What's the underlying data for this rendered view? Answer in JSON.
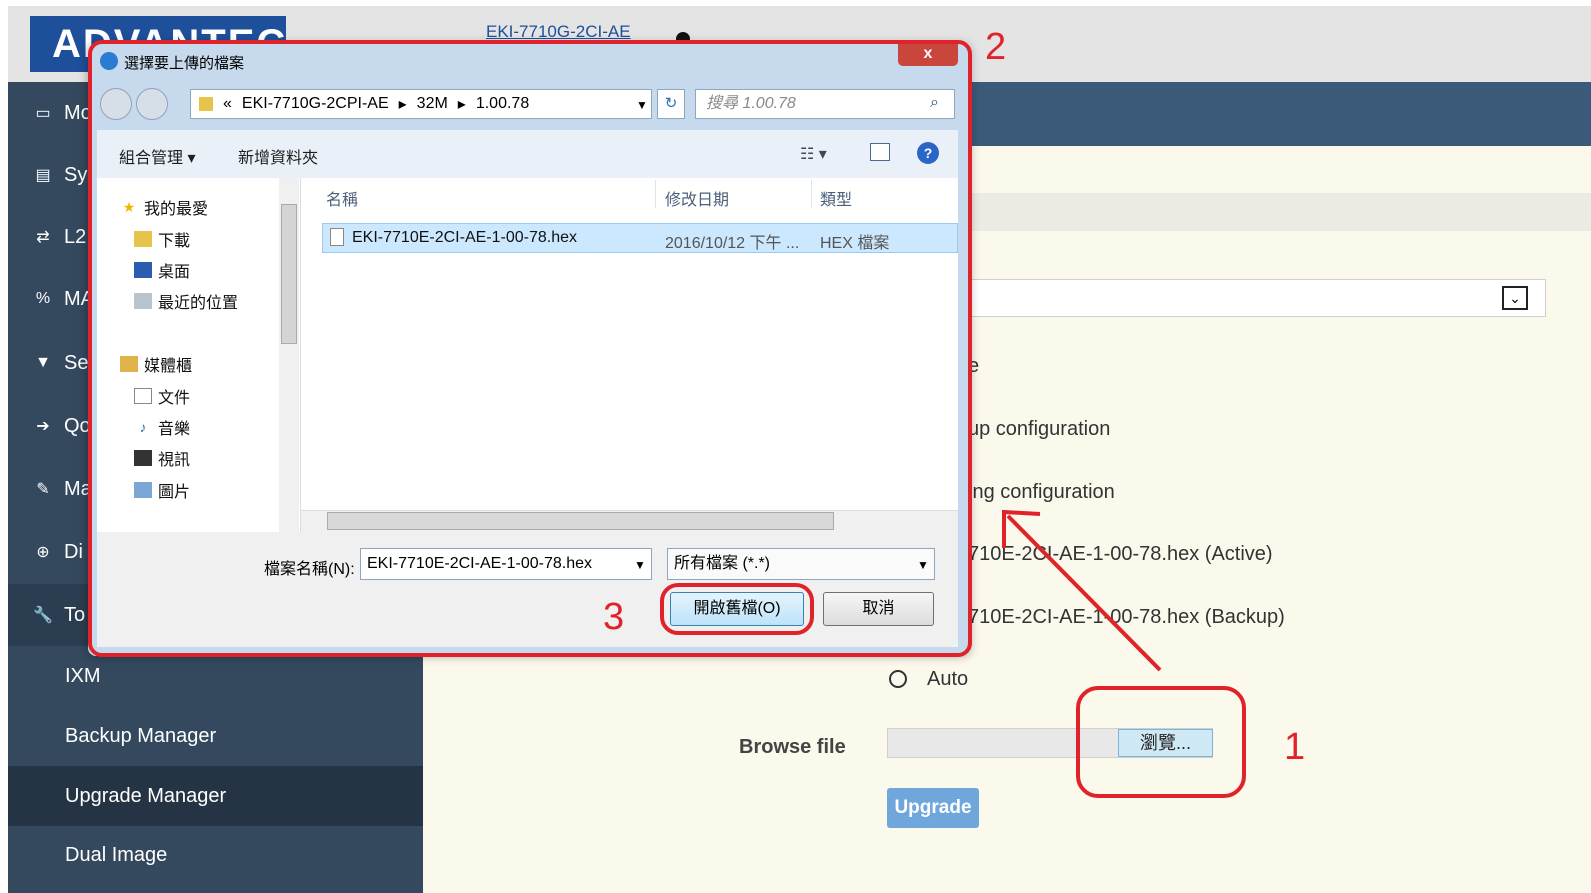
{
  "app": {
    "logo_text": "ADVANTECH",
    "model": "EKI-7710G-2CI-AE"
  },
  "sidebar": {
    "items": [
      {
        "label": "Mo",
        "icon": "monitor-icon"
      },
      {
        "label": "Sy",
        "icon": "system-icon"
      },
      {
        "label": "L2",
        "icon": "swap-icon"
      },
      {
        "label": "MA",
        "icon": "link-icon"
      },
      {
        "label": "Se",
        "icon": "shield-icon"
      },
      {
        "label": "Qo",
        "icon": "signin-icon"
      },
      {
        "label": "Ma",
        "icon": "edit-icon"
      },
      {
        "label": "Di",
        "icon": "zoom-icon"
      },
      {
        "label": "To",
        "icon": "wrench-icon"
      }
    ],
    "sub_items": [
      "IXM",
      "Backup Manager",
      "Upgrade Manager",
      "Dual Image"
    ]
  },
  "main": {
    "opt1": "e",
    "opt2": "up configuration",
    "opt3": "ing configuration",
    "opt4": "710E-2CI-AE-1-00-78.hex (Active)",
    "opt5": "710E-2CI-AE-1-00-78.hex (Backup)",
    "auto_label": "Auto",
    "browse_label": "Browse file",
    "browse_button": "瀏覽...",
    "upgrade_button": "Upgrade"
  },
  "annotations": {
    "n1": "1",
    "n2": "2",
    "n3": "3"
  },
  "dialog": {
    "title": "選擇要上傳的檔案",
    "close": "x",
    "breadcrumb": [
      "«",
      "EKI-7710G-2CPI-AE",
      "32M",
      "1.00.78"
    ],
    "search_placeholder": "搜尋 1.00.78",
    "organize": "組合管理 ▾",
    "new_folder": "新增資料夾",
    "favorites": "我的最愛",
    "fav_items": [
      "下載",
      "桌面",
      "最近的位置"
    ],
    "libraries": "媒體櫃",
    "lib_items": [
      "文件",
      "音樂",
      "視訊",
      "圖片"
    ],
    "col_name": "名稱",
    "col_date": "修改日期",
    "col_type": "類型",
    "file_name": "EKI-7710E-2CI-AE-1-00-78.hex",
    "file_date": "2016/10/12 下午 ...",
    "file_type": "HEX 檔案",
    "fn_label": "檔案名稱(N):",
    "fn_value": "EKI-7710E-2CI-AE-1-00-78.hex",
    "type_value": "所有檔案 (*.*)",
    "open_button": "開啟舊檔(O)",
    "cancel_button": "取消"
  },
  "colors": {
    "annotation": "#e0232a",
    "sidebar": "#34495e",
    "header": "#3b5a79",
    "content_bg": "#fbf8ec"
  }
}
